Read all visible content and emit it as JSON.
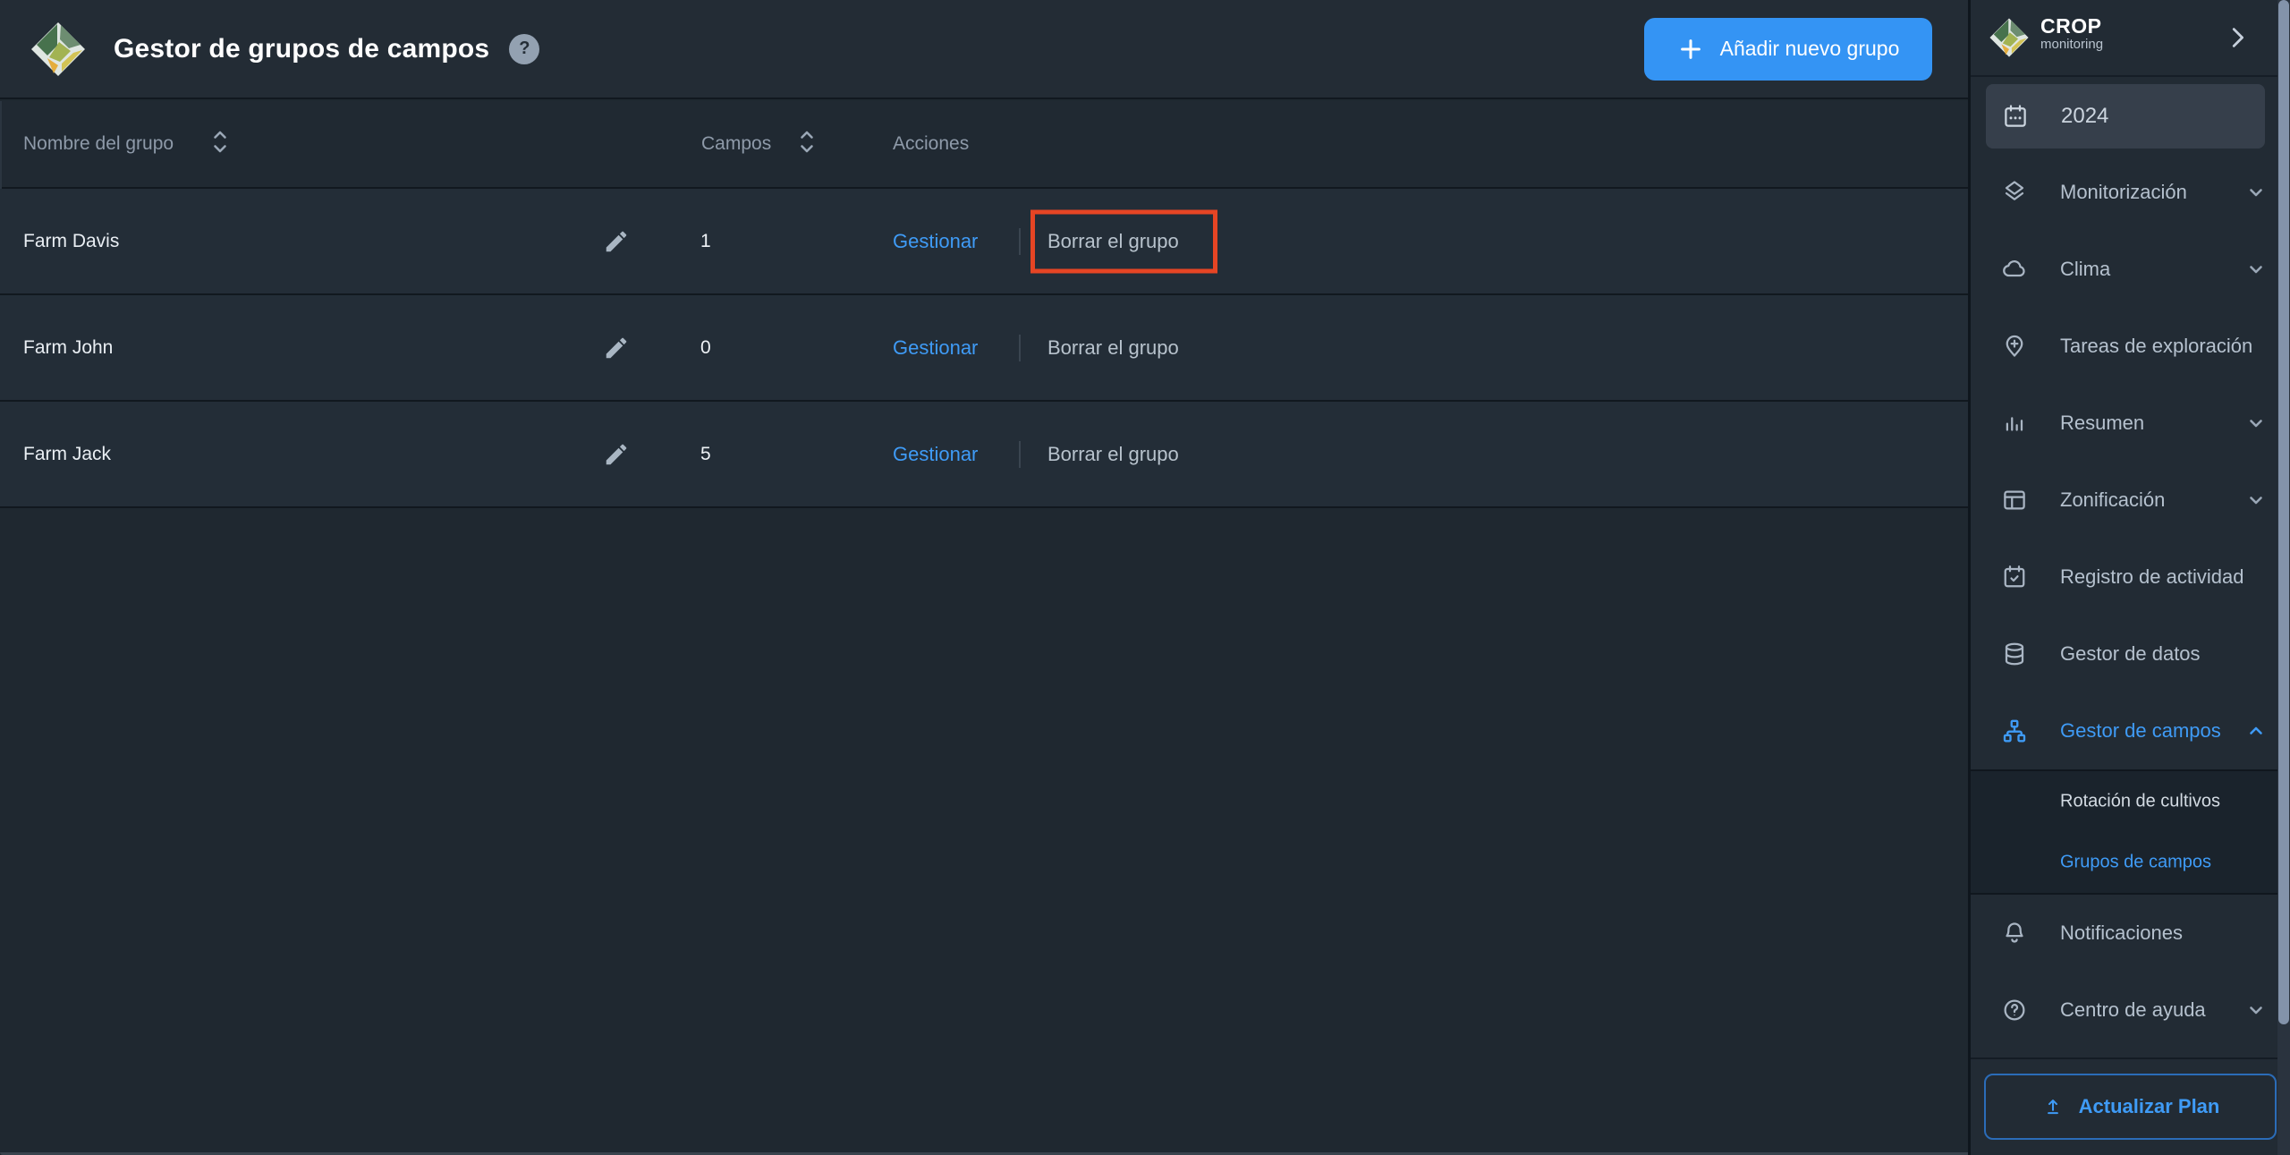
{
  "header": {
    "title": "Gestor de grupos de campos",
    "help_label": "?",
    "add_button": {
      "label": "Añadir nuevo grupo",
      "icon": "plus-icon"
    }
  },
  "table": {
    "columns": [
      {
        "label": "Nombre del grupo",
        "sortable": true
      },
      {
        "label": "Campos",
        "sortable": true
      },
      {
        "label": "Acciones",
        "sortable": false
      }
    ],
    "rows": [
      {
        "name": "Farm Davis",
        "campos": "1",
        "manage": "Gestionar",
        "delete": "Borrar el grupo",
        "delete_highlighted": true
      },
      {
        "name": "Farm John",
        "campos": "0",
        "manage": "Gestionar",
        "delete": "Borrar el grupo",
        "delete_highlighted": false
      },
      {
        "name": "Farm Jack",
        "campos": "5",
        "manage": "Gestionar",
        "delete": "Borrar el grupo",
        "delete_highlighted": false
      }
    ],
    "highlight": {
      "row_index": 0,
      "target": "Borrar el grupo",
      "color": "#e64524"
    }
  },
  "sidebar": {
    "brand": {
      "name": "CROP",
      "subtitle": "monitoring"
    },
    "collapse_icon": "chevron-right-icon",
    "year": {
      "label": "2024",
      "icon": "calendar-icon"
    },
    "items": [
      {
        "label": "Monitorización",
        "icon": "layers-icon",
        "chevron": "down",
        "active": false
      },
      {
        "label": "Clima",
        "icon": "cloud-icon",
        "chevron": "down",
        "active": false
      },
      {
        "label": "Tareas de exploración",
        "icon": "pin-plus-icon",
        "chevron": "",
        "active": false
      },
      {
        "label": "Resumen",
        "icon": "bar-chart-icon",
        "chevron": "down",
        "active": false
      },
      {
        "label": "Zonificación",
        "icon": "layout-icon",
        "chevron": "down",
        "active": false
      },
      {
        "label": "Registro de actividad",
        "icon": "calendar-check-icon",
        "chevron": "",
        "active": false
      },
      {
        "label": "Gestor de datos",
        "icon": "database-icon",
        "chevron": "",
        "active": false
      },
      {
        "label": "Gestor de campos",
        "icon": "sitemap-icon",
        "chevron": "up",
        "active": true
      }
    ],
    "subitems": [
      {
        "label": "Rotación de cultivos",
        "active": false
      },
      {
        "label": "Grupos de campos",
        "active": true
      }
    ],
    "bottom_items": [
      {
        "label": "Notificaciones",
        "icon": "bell-icon",
        "chevron": ""
      },
      {
        "label": "Centro de ayuda",
        "icon": "question-circle-icon",
        "chevron": "down"
      }
    ],
    "upgrade": {
      "label": "Actualizar Plan",
      "icon": "upload-icon"
    }
  },
  "colors": {
    "accent_blue": "#3494f4",
    "link_blue": "#3f9bf6",
    "highlight_red": "#e64524",
    "background": "#1f2830",
    "row_panel": "#232d37",
    "sidebar_panel": "#222b34"
  }
}
